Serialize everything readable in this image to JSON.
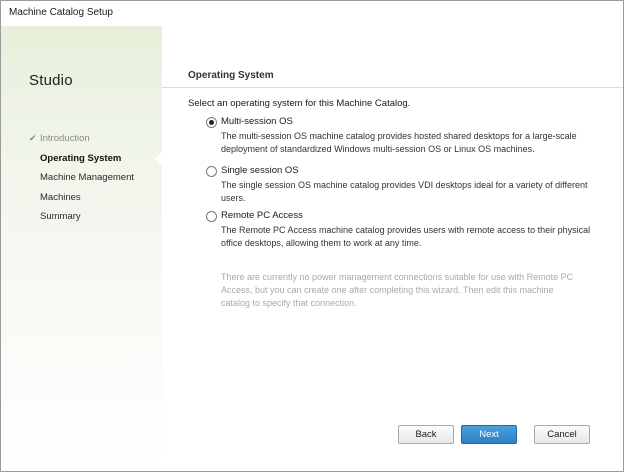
{
  "window": {
    "title": "Machine Catalog Setup"
  },
  "sidebar": {
    "brand": "Studio",
    "check_glyph": "✔",
    "steps": [
      {
        "label": "Introduction",
        "state": "done"
      },
      {
        "label": "Operating System",
        "state": "current"
      },
      {
        "label": "Machine Management",
        "state": "pending"
      },
      {
        "label": "Machines",
        "state": "pending"
      },
      {
        "label": "Summary",
        "state": "pending"
      }
    ]
  },
  "main": {
    "heading": "Operating System",
    "prompt": "Select an operating system for this Machine Catalog.",
    "options": [
      {
        "label": "Multi-session OS",
        "description": "The multi-session OS machine catalog provides hosted shared desktops for a large-scale deployment of standardized Windows multi-session OS or Linux OS machines.",
        "selected": true
      },
      {
        "label": "Single session OS",
        "description": "The single session OS machine catalog provides VDI desktops ideal for a variety of different users.",
        "selected": false
      },
      {
        "label": "Remote PC Access",
        "description": "The Remote PC Access machine catalog provides users with remote access to their physical office desktops, allowing them to work at any time.",
        "selected": false
      }
    ],
    "note": "There are currently no power management connections suitable for use with Remote PC Access, but you can create one after completing this wizard. Then edit this machine catalog to specify that connection."
  },
  "footer": {
    "back_label": "Back",
    "next_label": "Next",
    "cancel_label": "Cancel"
  },
  "colors": {
    "primary_button": "#2b7fc4",
    "sidebar_tint": "#e7efd9",
    "disabled_text": "#a9a9a9"
  }
}
